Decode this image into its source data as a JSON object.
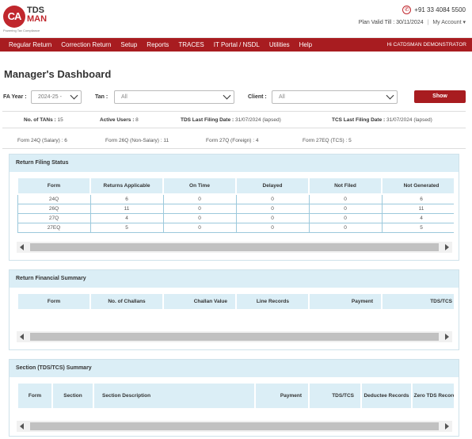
{
  "header": {
    "logo_tds": "TDS",
    "logo_man": "MAN",
    "logo_ca": "CA",
    "logo_tagline": "Powering Tax Compliance",
    "phone": "+91 33 4084 5500",
    "plan_valid": "Plan Valid Till : 30/11/2024",
    "my_account": "My Account ▾"
  },
  "menu": {
    "items": [
      "Regular Return",
      "Correction Return",
      "Setup",
      "Reports",
      "TRACES",
      "IT Portal / NSDL",
      "Utilities",
      "Help"
    ],
    "user": "Hi CATDSMAN DEMONSTRATOR"
  },
  "page_title": "Manager's Dashboard",
  "filters": {
    "fa_year_label": "FA Year :",
    "fa_year_value": "2024-25 -",
    "tan_label": "Tan :",
    "tan_value": "All",
    "client_label": "Client :",
    "client_value": "All",
    "show_label": "Show"
  },
  "stats": {
    "tans_label": "No. of TANs :",
    "tans_value": "15",
    "users_label": "Active Users :",
    "users_value": "8",
    "tds_label": "TDS Last Filing Date :",
    "tds_value": "31/07/2024 (lapsed)",
    "tcs_label": "TCS Last Filing Date :",
    "tcs_value": "31/07/2024 (lapsed)"
  },
  "forms": [
    "Form 24Q (Salary) : 6",
    "Form 26Q (Non-Salary) : 11",
    "Form 27Q (Foreign) : 4",
    "Form 27EQ (TCS) : 5"
  ],
  "filing_status": {
    "title": "Return Filing Status",
    "headers": [
      "Form",
      "Returns Applicable",
      "On Time",
      "Delayed",
      "Not Filed",
      "Not Generated"
    ],
    "rows": [
      [
        "24Q",
        "6",
        "0",
        "0",
        "0",
        "6"
      ],
      [
        "26Q",
        "11",
        "0",
        "0",
        "0",
        "11"
      ],
      [
        "27Q",
        "4",
        "0",
        "0",
        "0",
        "4"
      ],
      [
        "27EQ",
        "5",
        "0",
        "0",
        "0",
        "5"
      ]
    ]
  },
  "financial_summary": {
    "title": "Return Financial Summary",
    "headers": [
      "Form",
      "No. of Challans",
      "Challan Value",
      "Line Records",
      "Payment",
      "TDS/TCS"
    ]
  },
  "section_summary": {
    "title": "Section (TDS/TCS) Summary",
    "headers": [
      "Form",
      "Section",
      "Section Description",
      "Payment",
      "TDS/TCS",
      "Deductee Records",
      "Zero TDS Records"
    ]
  },
  "colors": {
    "brand_red": "#a81c20",
    "panel_blue": "#dbeef6"
  }
}
